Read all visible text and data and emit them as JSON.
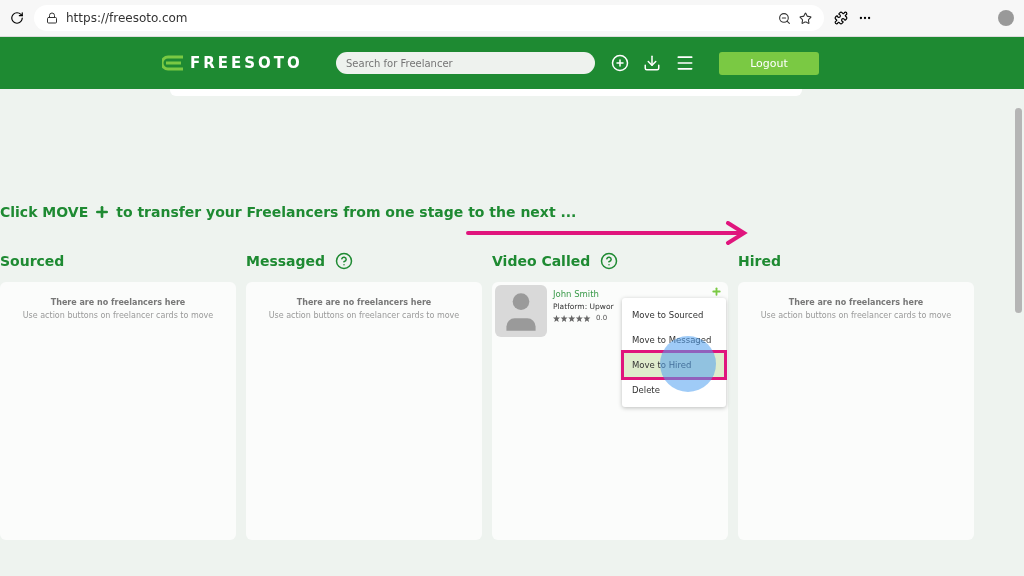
{
  "browser": {
    "url": "https://freesoto.com"
  },
  "header": {
    "logo": "FREESOTO",
    "search": {
      "placeholder": "Search for Freelancer"
    },
    "logout": "Logout"
  },
  "instruction": {
    "before": "Click MOVE",
    "after": "to transfer your Freelancers from one stage to the next ..."
  },
  "columns": [
    {
      "title": "Sourced",
      "help_icon": false,
      "empty_title": "There are no freelancers here",
      "empty_hint": "Use action buttons on freelancer cards to move"
    },
    {
      "title": "Messaged",
      "help_icon": true,
      "empty_title": "There are no freelancers here",
      "empty_hint": "Use action buttons on freelancer cards to move"
    },
    {
      "title": "Video Called",
      "help_icon": true,
      "cards": [
        {
          "name": "John Smith",
          "platform": "Platform: Upwor",
          "rating": "0.0",
          "menu": [
            {
              "label": "Move to Sourced",
              "selected": false
            },
            {
              "label": "Move to Messaged",
              "selected": false
            },
            {
              "label": "Move to Hired",
              "selected": true
            },
            {
              "label": "Delete",
              "selected": false
            }
          ]
        }
      ]
    },
    {
      "title": "Hired",
      "help_icon": false,
      "empty_title": "There are no freelancers here",
      "empty_hint": "Use action buttons on freelancer cards to move"
    }
  ]
}
